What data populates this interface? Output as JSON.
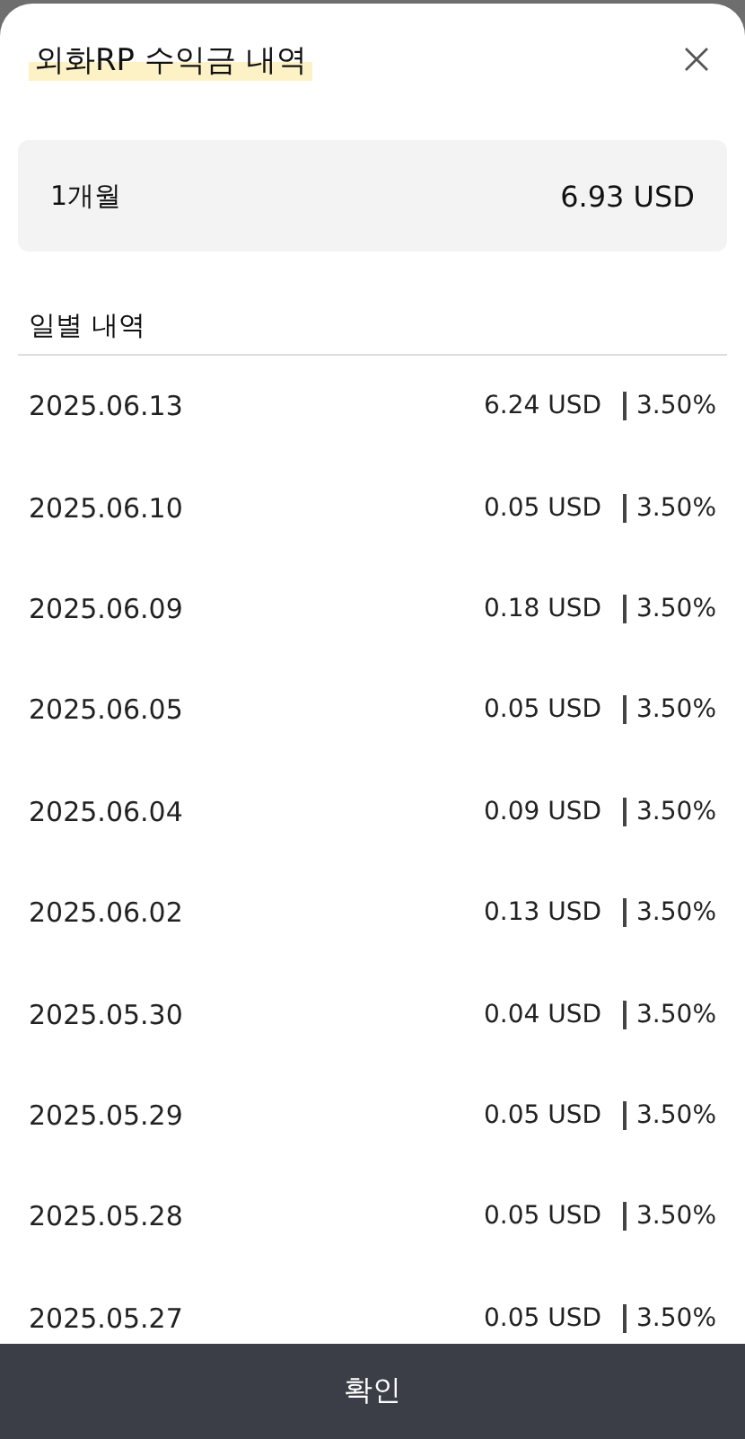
{
  "title": "외화RP 수익금 내역",
  "summary": {
    "period": "1개월",
    "amount": "6.93 USD"
  },
  "section_title": "일별 내역",
  "rows": [
    {
      "date": "2025.06.13",
      "amount": "6.24 USD",
      "rate": "3.50%"
    },
    {
      "date": "2025.06.10",
      "amount": "0.05 USD",
      "rate": "3.50%"
    },
    {
      "date": "2025.06.09",
      "amount": "0.18 USD",
      "rate": "3.50%"
    },
    {
      "date": "2025.06.05",
      "amount": "0.05 USD",
      "rate": "3.50%"
    },
    {
      "date": "2025.06.04",
      "amount": "0.09 USD",
      "rate": "3.50%"
    },
    {
      "date": "2025.06.02",
      "amount": "0.13 USD",
      "rate": "3.50%"
    },
    {
      "date": "2025.05.30",
      "amount": "0.04 USD",
      "rate": "3.50%"
    },
    {
      "date": "2025.05.29",
      "amount": "0.05 USD",
      "rate": "3.50%"
    },
    {
      "date": "2025.05.28",
      "amount": "0.05 USD",
      "rate": "3.50%"
    },
    {
      "date": "2025.05.27",
      "amount": "0.05 USD",
      "rate": "3.50%"
    }
  ],
  "confirm_button": "확인"
}
